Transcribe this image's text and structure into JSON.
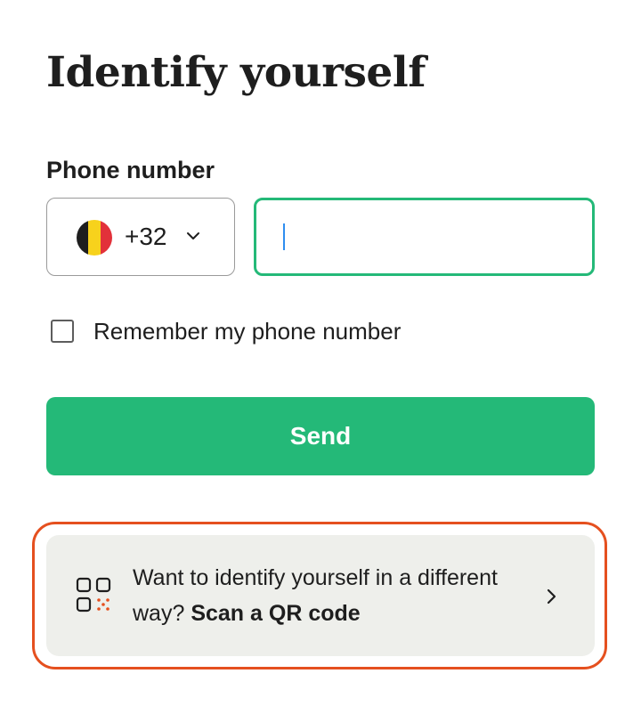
{
  "page": {
    "title": "Identify yourself"
  },
  "phone": {
    "label": "Phone number",
    "country": {
      "flag": "belgium-flag",
      "flag_colors": [
        "#1e1e1e",
        "#f7d21c",
        "#e2313a"
      ],
      "dial_code": "+32"
    },
    "input": {
      "value": "",
      "placeholder": ""
    }
  },
  "remember": {
    "label": "Remember my phone number",
    "checked": false
  },
  "send_button": {
    "label": "Send"
  },
  "alternative": {
    "prefix": "Want to identify yourself in a different way?",
    "link_text": "Scan a QR code",
    "icon": "qr-code-icon",
    "trailing_icon": "chevron-right-icon"
  },
  "colors": {
    "accent": "#24b978",
    "focus_ring": "#e5501f",
    "card_background": "#eeefeb",
    "text": "#1e1e1e"
  }
}
